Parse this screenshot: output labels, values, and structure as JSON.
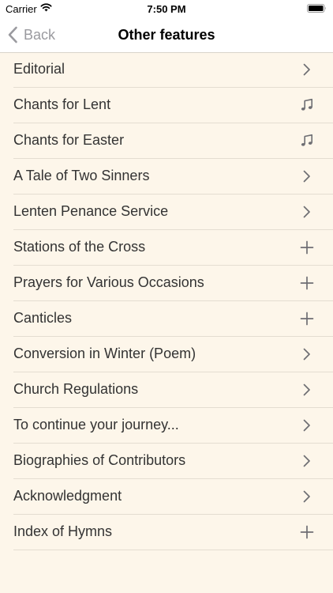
{
  "status_bar": {
    "carrier": "Carrier",
    "time": "7:50 PM"
  },
  "nav": {
    "back_label": "Back",
    "title": "Other features"
  },
  "colors": {
    "background": "#fdf6ea",
    "bar_background": "#ffffff",
    "label_text": "#333333",
    "accessory_gray": "#6e6e73"
  },
  "items": [
    {
      "label": "Editorial",
      "icon": "chevron-right-icon"
    },
    {
      "label": "Chants for Lent",
      "icon": "music-note-icon"
    },
    {
      "label": "Chants for Easter",
      "icon": "music-note-icon"
    },
    {
      "label": "A Tale of Two Sinners",
      "icon": "chevron-right-icon"
    },
    {
      "label": "Lenten Penance Service",
      "icon": "chevron-right-icon"
    },
    {
      "label": "Stations of the Cross",
      "icon": "plus-icon"
    },
    {
      "label": "Prayers for Various Occasions",
      "icon": "plus-icon"
    },
    {
      "label": "Canticles",
      "icon": "plus-icon"
    },
    {
      "label": "Conversion in Winter (Poem)",
      "icon": "chevron-right-icon"
    },
    {
      "label": "Church Regulations",
      "icon": "chevron-right-icon"
    },
    {
      "label": "To continue your journey...",
      "icon": "chevron-right-icon"
    },
    {
      "label": "Biographies of Contributors",
      "icon": "chevron-right-icon"
    },
    {
      "label": "Acknowledgment",
      "icon": "chevron-right-icon"
    },
    {
      "label": "Index of Hymns",
      "icon": "plus-icon"
    }
  ]
}
